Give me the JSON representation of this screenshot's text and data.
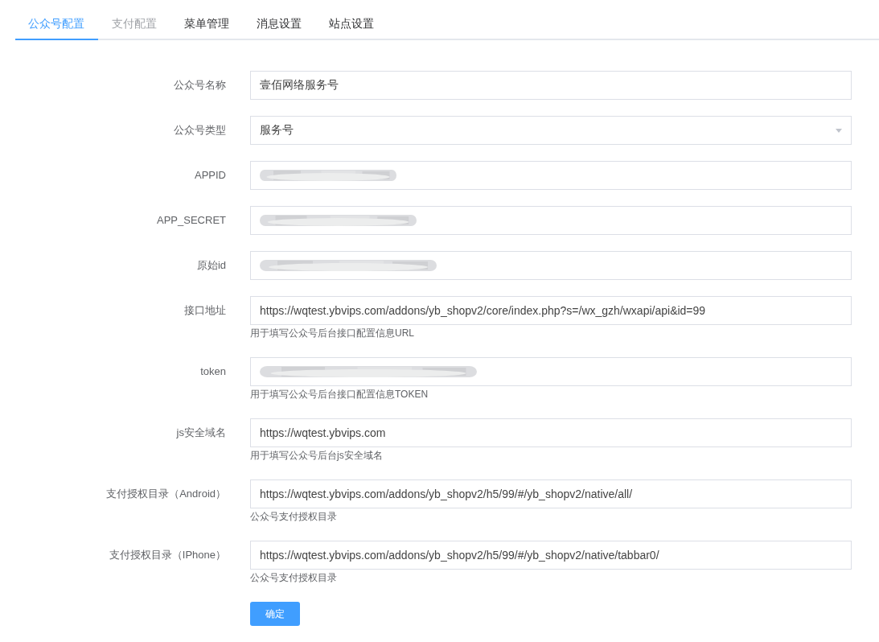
{
  "tabs": [
    {
      "label": "公众号配置",
      "selected": true,
      "disabled": false
    },
    {
      "label": "支付配置",
      "selected": false,
      "disabled": true
    },
    {
      "label": "菜单管理",
      "selected": false,
      "disabled": false
    },
    {
      "label": "消息设置",
      "selected": false,
      "disabled": false
    },
    {
      "label": "站点设置",
      "selected": false,
      "disabled": false
    }
  ],
  "form": {
    "fields": [
      {
        "label": "公众号名称",
        "kind": "text",
        "value": "壹佰网络服务号"
      },
      {
        "label": "公众号类型",
        "kind": "select",
        "value": "服务号"
      },
      {
        "label": "APPID",
        "kind": "blurred"
      },
      {
        "label": "APP_SECRET",
        "kind": "blurred"
      },
      {
        "label": "原始id",
        "kind": "blurred"
      },
      {
        "label": "接口地址",
        "kind": "text",
        "value": "https://wqtest.ybvips.com/addons/yb_shopv2/core/index.php?s=/wx_gzh/wxapi/api&id=99",
        "hint": "用于填写公众号后台接口配置信息URL"
      },
      {
        "label": "token",
        "kind": "blurred",
        "hint": "用于填写公众号后台接口配置信息TOKEN"
      },
      {
        "label": "js安全域名",
        "kind": "text",
        "value": "https://wqtest.ybvips.com",
        "hint": "用于填写公众号后台js安全域名"
      },
      {
        "label": "支付授权目录（Android）",
        "kind": "text",
        "value": "https://wqtest.ybvips.com/addons/yb_shopv2/h5/99/#/yb_shopv2/native/all/",
        "hint": "公众号支付授权目录"
      },
      {
        "label": "支付授权目录（IPhone）",
        "kind": "text",
        "value": "https://wqtest.ybvips.com/addons/yb_shopv2/h5/99/#/yb_shopv2/native/tabbar0/",
        "hint": "公众号支付授权目录"
      }
    ],
    "submit": "确定"
  }
}
